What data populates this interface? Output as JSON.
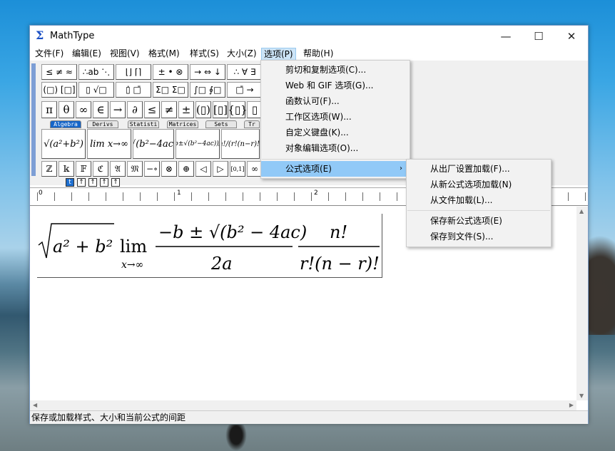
{
  "window": {
    "title": "MathType",
    "app_icon": "Σ",
    "minimize": "—",
    "maximize": "☐",
    "close": "✕"
  },
  "menubar": {
    "items": [
      "文件(F)",
      "编辑(E)",
      "视图(V)",
      "格式(M)",
      "样式(S)",
      "大小(Z)",
      "选项(P)",
      "帮助(H)"
    ]
  },
  "palette": {
    "row1": [
      "≤ ≠ ≈",
      "∴ab ⋱",
      "⌊⌋ ⌈⌉",
      "± • ⊗",
      "→ ⇔ ↓",
      "∴ ∀ ∃"
    ],
    "row2": [
      "(□) [□]",
      "▯ √□",
      "▯̇ □̄",
      "Σ□ Σ□",
      "∫□ ∮□",
      "□̄ →"
    ],
    "symbols": [
      "π",
      "θ",
      "∞",
      "∈",
      "→",
      "∂",
      "≤",
      "≠",
      "±",
      "(▯)",
      "[▯]",
      "{▯}",
      "▯"
    ],
    "tabs": [
      "Algebra",
      "Derivs",
      "Statisti",
      "Matrices",
      "Sets",
      "Tr"
    ],
    "templates": [
      "√(a²+b²)",
      "lim x→∞",
      "√(b²−4ac)",
      "(−b±√(b²−4ac))/2a",
      "n!/(r!(n−r)!)"
    ],
    "row4": [
      "ℤ",
      "𝕜",
      "𝔽",
      "ℭ",
      "𝔄",
      "𝔐",
      "−∘",
      "⊗",
      "⊕",
      "◁",
      "▷",
      "[0,1]",
      "∞"
    ],
    "small_toolbar": [
      "t",
      "↑",
      "↑",
      "↑",
      "↑"
    ]
  },
  "ruler": {
    "marks": [
      "0",
      "1",
      "2"
    ]
  },
  "equation": {
    "sqrt_radicand": "a² + b²",
    "lim": "lim",
    "lim_sub": "x→∞",
    "quad_num": "−b ± √(b² − 4ac)",
    "quad_den": "2a",
    "comb_num": "n!",
    "comb_den": "r!(n − r)!"
  },
  "options_menu": {
    "items": [
      "剪切和复制选项(C)...",
      "Web 和 GIF 选项(G)...",
      "函数认可(F)...",
      "工作区选项(W)...",
      "自定义键盘(K)...",
      "对象编辑选项(O)...",
      "公式选项(E)"
    ],
    "submenu_arrow": "›"
  },
  "formula_submenu": {
    "items": [
      "从出厂设置加载(F)...",
      "从新公式选项加载(N)",
      "从文件加载(L)...",
      "保存新公式选项(E)",
      "保存到文件(S)..."
    ]
  },
  "statusbar": {
    "text": "保存或加载样式、大小和当前公式的间距"
  },
  "colors": {
    "accent": "#91c9f7",
    "tab_selected": "#1565c8",
    "palette_bg": "#f0f0f0"
  }
}
